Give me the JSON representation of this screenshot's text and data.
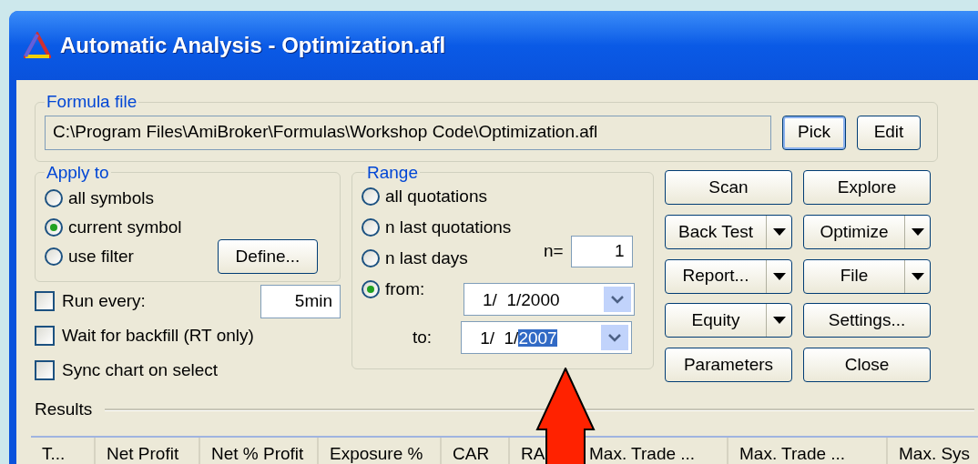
{
  "window": {
    "title": "Automatic Analysis - Optimization.afl"
  },
  "formula_file": {
    "label": "Formula file",
    "path": "C:\\Program Files\\AmiBroker\\Formulas\\Workshop Code\\Optimization.afl",
    "buttons": [
      {
        "label": "Pick",
        "focused": true
      },
      {
        "label": "Edit",
        "focused": false
      }
    ]
  },
  "apply_to": {
    "label": "Apply to",
    "options": [
      {
        "label": "all symbols",
        "selected": false
      },
      {
        "label": "current symbol",
        "selected": true
      },
      {
        "label": "use filter",
        "selected": false
      }
    ],
    "define_button": "Define..."
  },
  "checkboxes": [
    {
      "label": "Run every:",
      "checked": false,
      "value": "5min"
    },
    {
      "label": "Wait for backfill (RT only)",
      "checked": false
    },
    {
      "label": "Sync chart on select",
      "checked": false
    }
  ],
  "range": {
    "label": "Range",
    "options": [
      {
        "label": "all quotations",
        "selected": false
      },
      {
        "label": "n last quotations",
        "selected": false
      },
      {
        "label": "n last days",
        "selected": false
      },
      {
        "label": "from:",
        "selected": true
      }
    ],
    "n_label": "n=",
    "n_value": "1",
    "from_date": {
      "text": "1/  1/2000"
    },
    "to_label": "to:",
    "to_date": {
      "text": "1/  1/",
      "selected_text": "2007"
    }
  },
  "actions": [
    {
      "label": "Scan",
      "dropdown": false
    },
    {
      "label": "Explore",
      "dropdown": false
    },
    {
      "label": "Back Test",
      "dropdown": true
    },
    {
      "label": "Optimize",
      "dropdown": true
    },
    {
      "label": "Report...",
      "dropdown": true
    },
    {
      "label": "File",
      "dropdown": true
    },
    {
      "label": "Equity",
      "dropdown": true
    },
    {
      "label": "Settings...",
      "dropdown": false
    },
    {
      "label": "Parameters",
      "dropdown": false
    },
    {
      "label": "Close",
      "dropdown": false
    }
  ],
  "results": {
    "label": "Results",
    "columns": [
      "T...",
      "Net Profit",
      "Net % Profit",
      "Exposure %",
      "CAR",
      "RA",
      "Max. Trade ...",
      "Max. Trade ...",
      "Max. Sys"
    ]
  }
}
